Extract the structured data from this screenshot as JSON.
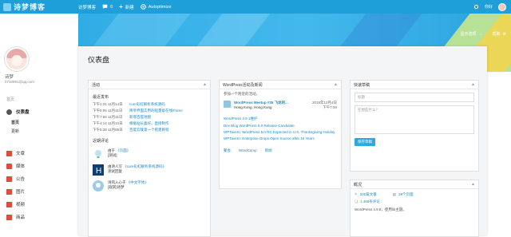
{
  "topbar": {
    "logo": "诗梦博客",
    "home_label": "访梦博客",
    "comments_count": "0",
    "new_label": "新建",
    "plugin_label": "Autoptimize",
    "user_label": "你好",
    "colors": {
      "bar": "#1e9fd9",
      "accent": "#2ea8de"
    }
  },
  "banner": {
    "screen_options": "显示选项",
    "help": "帮助"
  },
  "profile": {
    "name": "诗梦",
    "email": "2710991@qq.com"
  },
  "menu": {
    "group_label": "首页",
    "dashboard": "仪表盘",
    "sub_home": "首页",
    "sub_updates": "更新",
    "items": [
      "文章",
      "媒体",
      "公告",
      "图片",
      "视频",
      "商品"
    ]
  },
  "main": {
    "title": "仪表盘"
  },
  "activity": {
    "header": "活动",
    "recent_published": "最近发布",
    "posts": [
      {
        "time": "下午1:31 11月14日",
        "title": "cure彩虹解析系统源码"
      },
      {
        "time": "下午9:05 11月11日",
        "title": "简单界面实用的轻量级在线Iframe"
      },
      {
        "time": "下午7:56 11月11日",
        "title": "新增百度地图"
      },
      {
        "time": "下午4:14 11月10日",
        "title": "根据站长喜好，直接制作"
      },
      {
        "time": "下午5:38 11月05日",
        "title": "百度云联第一个搭建教程"
      }
    ],
    "recent_comments": "近期评论",
    "comments": [
      {
        "author": "由于",
        "on": "由来",
        "link": "《页面》",
        "text": "[测试]"
      },
      {
        "author": "由诗人写",
        "on": "由于",
        "link": "《cure彩虹解析系统源码》",
        "text": "测试回复"
      },
      {
        "author": "诗风入心于",
        "on": "由于",
        "link": "《中文字体》",
        "text": "[观赏]诗梦"
      }
    ]
  },
  "events": {
    "header": "WordPress活动及新闻",
    "intro": "参加一个附近的活动。",
    "event_title": "WordPress Meetup #35 飞龙的...",
    "event_date": "2019年12月4日",
    "event_time": "下午7:00",
    "location": "Hong Kong, Hong Kong",
    "news": [
      "WordPress 4.9.1维护",
      "Dev Blog WordPress 5.0 Release Candidate",
      "WPTavern: WordPress 5.0 RC Expected in U.S. Thanksgiving Holiday",
      "WPTavern: Enterprise Drops Open Source after 16 Years"
    ],
    "footer_links": [
      "聚会",
      "WordCamp",
      "新闻"
    ]
  },
  "quickdraft": {
    "header": "快速草稿",
    "title_placeholder": "标题",
    "content_placeholder": "在想些什么？",
    "save_button": "保存草稿"
  },
  "glance": {
    "header": "概况",
    "posts": "200篇文章",
    "pages": "28个页面",
    "comments": "1,468条评论",
    "version": "WordPress 4.9.8，使用lib主题。"
  }
}
